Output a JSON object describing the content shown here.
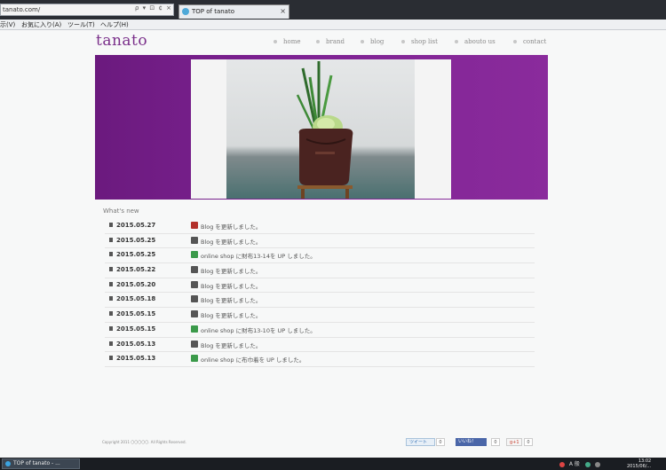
{
  "browser": {
    "address": "tanato.com/",
    "address_icons": "ρ ▾ ⊡ ¢ ×",
    "tab_title": "TOP of tanato",
    "tab_close": "×",
    "menu": [
      "示(V)",
      "お気に入り(A)",
      "ツール(T)",
      "ヘルプ(H)"
    ]
  },
  "site": {
    "title": "tanato",
    "nav": [
      "home",
      "brand",
      "blog",
      "shop list",
      "abouto us",
      "contact"
    ]
  },
  "news": {
    "heading": "What's new",
    "items": [
      {
        "date": "2015.05.27",
        "text": "Blog を更新しました。",
        "icon": "blog-red-icon",
        "icon_color": "#b3302b"
      },
      {
        "date": "2015.05.25",
        "text": "Blog を更新しました。",
        "icon": "blog-icon",
        "icon_color": "#555555"
      },
      {
        "date": "2015.05.25",
        "text": "online shop に財布13-14を UP しました。",
        "icon": "shop-icon",
        "icon_color": "#3b9a4a"
      },
      {
        "date": "2015.05.22",
        "text": "Blog を更新しました。",
        "icon": "blog-icon",
        "icon_color": "#555555"
      },
      {
        "date": "2015.05.20",
        "text": "Blog を更新しました。",
        "icon": "blog-icon",
        "icon_color": "#555555"
      },
      {
        "date": "2015.05.18",
        "text": "Blog を更新しました。",
        "icon": "blog-icon",
        "icon_color": "#555555"
      },
      {
        "date": "2015.05.15",
        "text": "Blog を更新しました。",
        "icon": "blog-icon",
        "icon_color": "#555555"
      },
      {
        "date": "2015.05.15",
        "text": "online shop に財布13-10を UP しました。",
        "icon": "shop-icon",
        "icon_color": "#3b9a4a"
      },
      {
        "date": "2015.05.13",
        "text": "Blog を更新しました。",
        "icon": "blog-icon",
        "icon_color": "#555555"
      },
      {
        "date": "2015.05.13",
        "text": "online shop に布巾着を UP しました。",
        "icon": "shop-icon",
        "icon_color": "#3b9a4a"
      }
    ]
  },
  "footer": {
    "copyright": "Copyright 2011 〇〇〇〇〇. All Rights Reserved.",
    "tweet_label": "ツイート",
    "tweet_count": "0",
    "like_label": "いいね！",
    "like_count": "0",
    "gplus_label": "g+1",
    "gplus_count": "0"
  },
  "taskbar": {
    "task": "TOP of tanato - ...",
    "tray_text": "A 般",
    "clock_time": "13:02",
    "clock_date": "2015/06/..."
  },
  "colors": {
    "accent": "#7a2f8a",
    "hero": "#7d2292"
  }
}
